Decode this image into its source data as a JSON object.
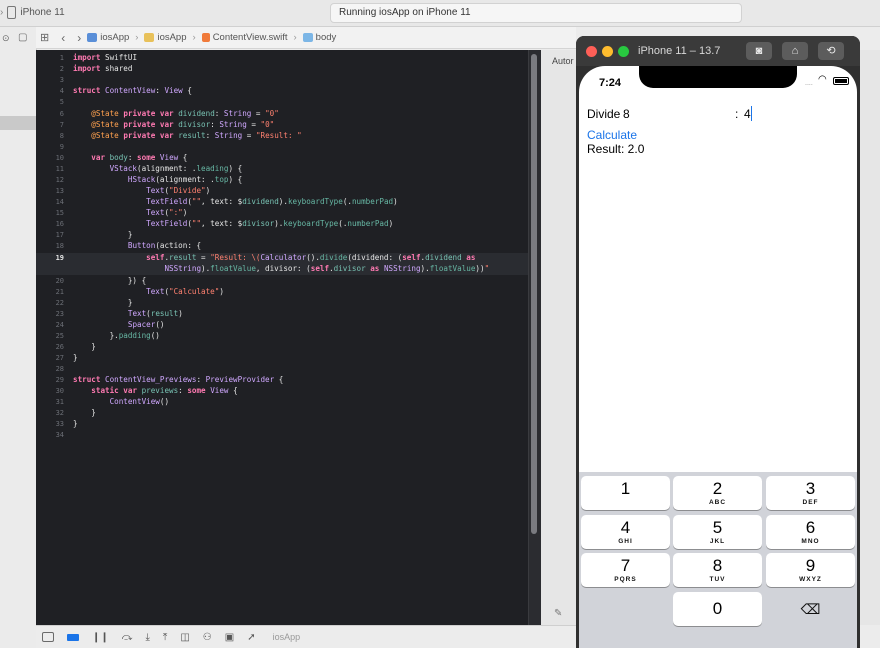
{
  "toolbar": {
    "scheme_device": "iPhone 11",
    "status": "Running iosApp on iPhone 11"
  },
  "jumpbar": {
    "crumbs": [
      "iosApp",
      "iosApp",
      "ContentView.swift",
      "body"
    ]
  },
  "editor": {
    "highlighted_line": 19,
    "line_numbers": [
      "1",
      "2",
      "3",
      "4",
      "5",
      "6",
      "7",
      "8",
      "9",
      "10",
      "11",
      "12",
      "13",
      "14",
      "15",
      "16",
      "17",
      "18",
      "19",
      "",
      "20",
      "21",
      "22",
      "23",
      "24",
      "25",
      "26",
      "27",
      "28",
      "29",
      "30",
      "31",
      "32",
      "33",
      "34"
    ]
  },
  "canvas": {
    "label": "Autor"
  },
  "debugbar": {
    "app": "iosApp"
  },
  "simulator": {
    "title": "iPhone 11 – 13.7",
    "time": "7:24",
    "signal": "....",
    "divide_label": "Divide",
    "dividend_value": "8",
    "colon_label": ":",
    "divisor_value": "4",
    "calculate_label": "Calculate",
    "result_text": "Result: 2.0",
    "keys": [
      {
        "digit": "1",
        "letters": ""
      },
      {
        "digit": "2",
        "letters": "ABC"
      },
      {
        "digit": "3",
        "letters": "DEF"
      },
      {
        "digit": "4",
        "letters": "GHI"
      },
      {
        "digit": "5",
        "letters": "JKL"
      },
      {
        "digit": "6",
        "letters": "MNO"
      },
      {
        "digit": "7",
        "letters": "PQRS"
      },
      {
        "digit": "8",
        "letters": "TUV"
      },
      {
        "digit": "9",
        "letters": "WXYZ"
      },
      {
        "digit": "0",
        "letters": ""
      }
    ],
    "delete_glyph": "⌫"
  },
  "colors": {
    "editor_bg": "#1f2024",
    "keyword": "#ff7ab2",
    "string": "#ff8170",
    "link_blue": "#1a74e8",
    "keypad_bg": "#d1d3d9"
  }
}
